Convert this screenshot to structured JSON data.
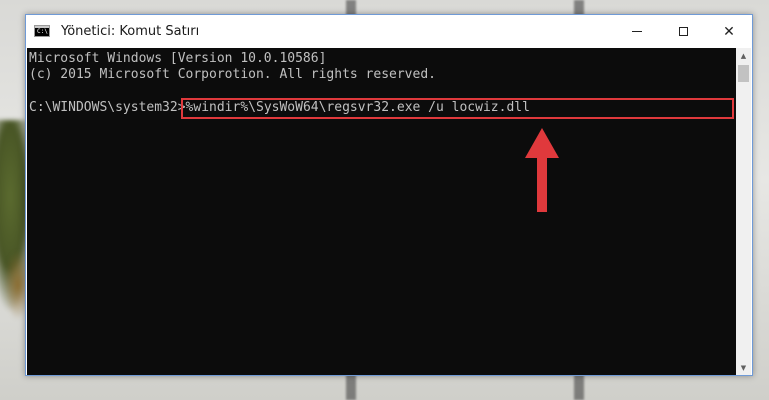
{
  "window": {
    "title": "Yönetici: Komut Satırı",
    "icon": "command-prompt-icon",
    "icon_text": "C:\\",
    "buttons": [
      "minimize-icon",
      "maximize-icon",
      "close-icon"
    ],
    "close_glyph": "✕"
  },
  "console": {
    "lines": [
      "Microsoft Windows [Version 10.0.10586]",
      "(c) 2015 Microsoft Corporotion. All rights reserved."
    ],
    "prompt": "C:\\WINDOWS\\system32>",
    "command": "%windir%\\SysWoW64\\regsvr32.exe /u locwiz.dll"
  },
  "annotation": {
    "highlight_color": "#e0393c",
    "arrow_color": "#e0393c",
    "arrow_icon": "up-arrow-icon"
  },
  "scrollbar": {
    "up_glyph": "▲",
    "down_glyph": "▼"
  },
  "colors": {
    "console_bg": "#0c0c0c",
    "console_text": "#c0c0c0",
    "window_border": "#6f9ad6"
  }
}
